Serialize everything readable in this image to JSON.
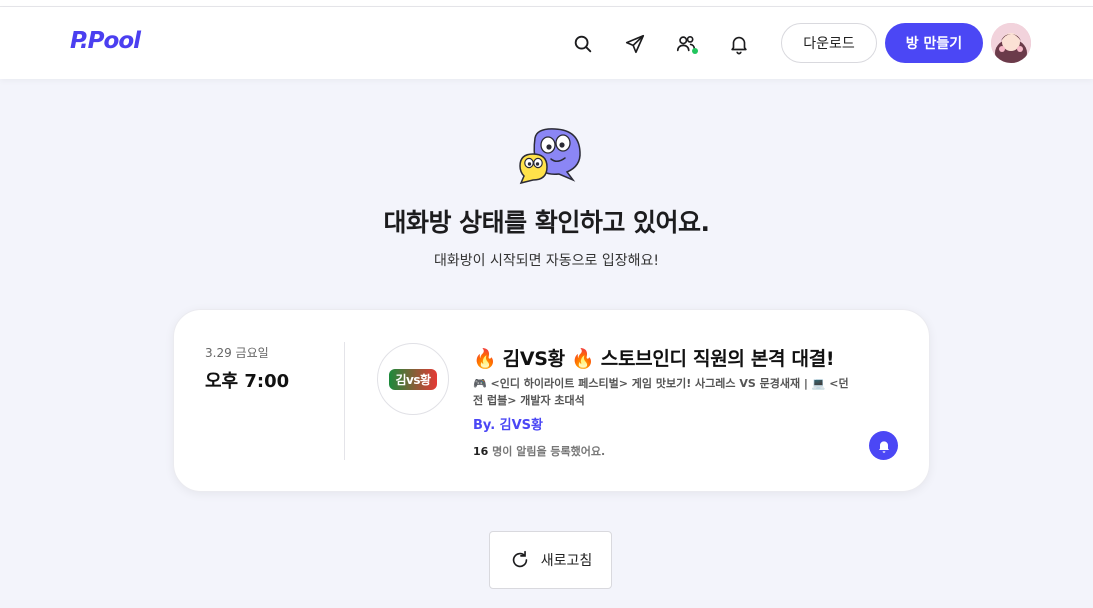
{
  "header": {
    "logo": "P.Pool",
    "download_label": "다운로드",
    "create_label": "방 만들기"
  },
  "status": {
    "title": "대화방 상태를 확인하고 있어요.",
    "subtitle": "대화방이 시작되면 자동으로 입장해요!"
  },
  "room": {
    "date": "3.29 금요일",
    "time": "오후 7:00",
    "thumbnail_text": "김vs황",
    "title": "🔥 김VS황 🔥 스토브인디 직원의 본격 대결!",
    "description": "🎮 <인디 하이라이트 페스티벌> 게임 맛보기! 사그레스 VS 문경새재 | 💻 <던전 럽블> 개발자 초대석",
    "by": "By. 김VS황",
    "subscriber_count": "16",
    "subscriber_suffix": " 명이 알림을 등록했어요."
  },
  "refresh_label": "새로고침",
  "colors": {
    "accent": "#4b47f5",
    "background": "#f3f4fb",
    "online": "#22c55e"
  },
  "icons": [
    "search-icon",
    "send-icon",
    "users-icon",
    "bell-icon",
    "refresh-icon"
  ]
}
